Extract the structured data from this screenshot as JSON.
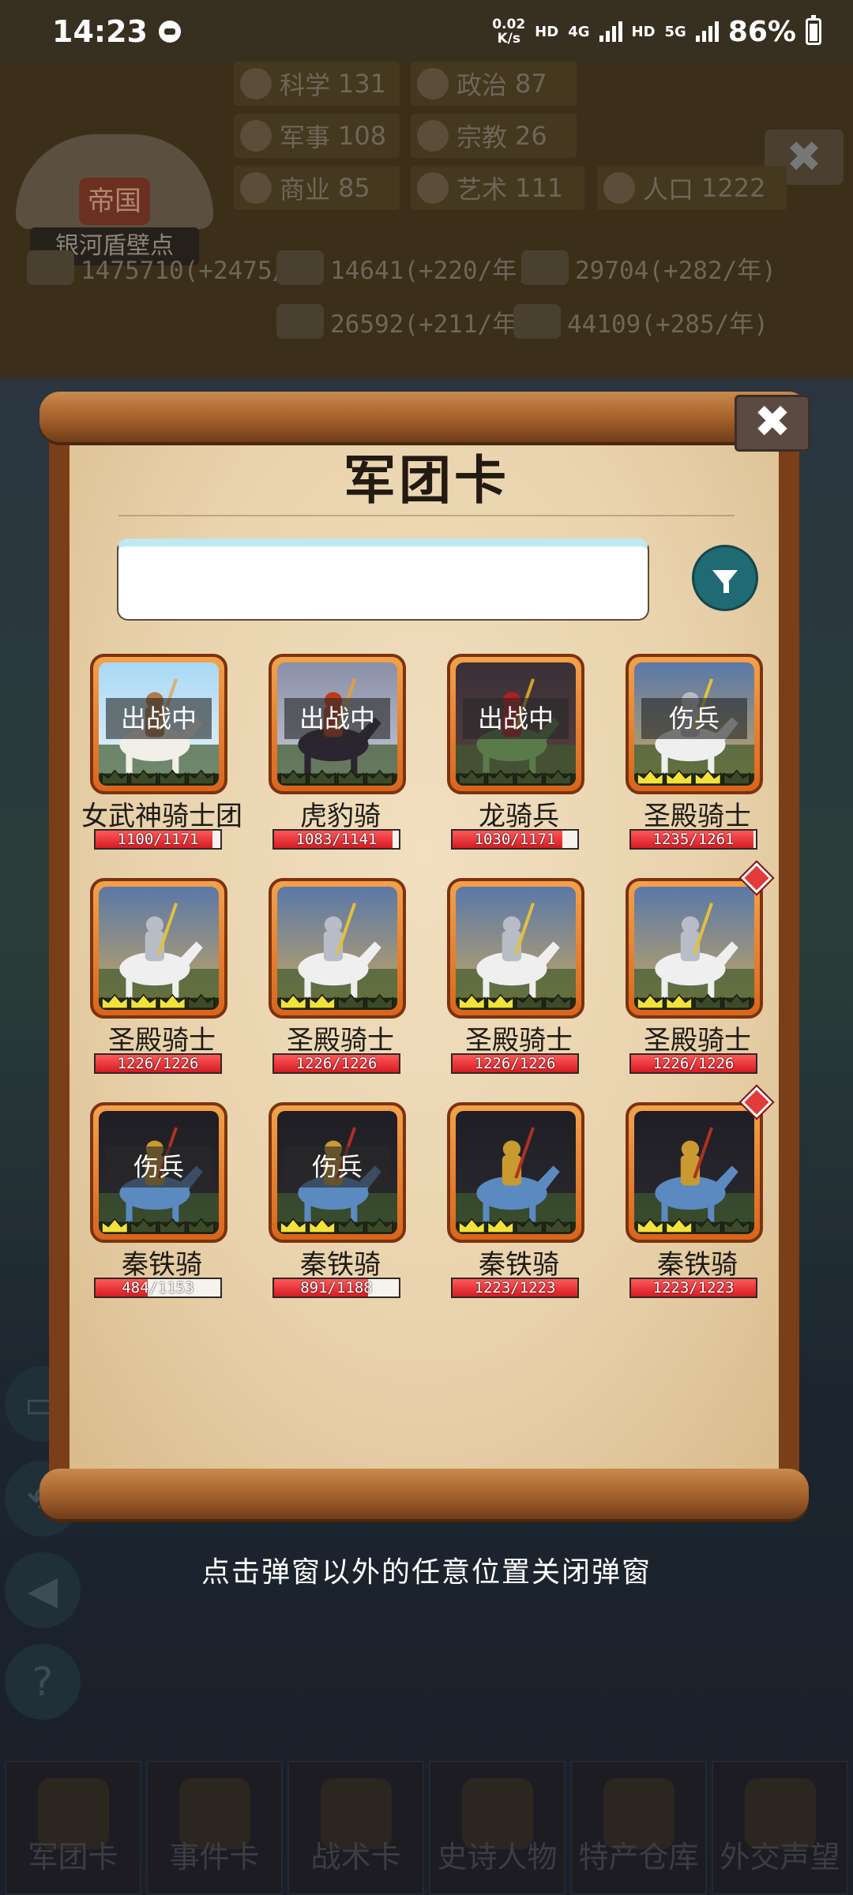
{
  "status_bar": {
    "time": "14:23",
    "net_speed_value": "0.02",
    "net_speed_unit": "K/s",
    "hd1": "HD",
    "net1": "4G",
    "hd2": "HD",
    "net2": "5G",
    "battery": "86%"
  },
  "background": {
    "emblem_title": "帝国",
    "emblem_name": "银河盾壁点",
    "stats": [
      {
        "label": "科学",
        "value": "131"
      },
      {
        "label": "政治",
        "value": "87"
      },
      {
        "label": "军事",
        "value": "108"
      },
      {
        "label": "宗教",
        "value": "26"
      },
      {
        "label": "商业",
        "value": "85"
      },
      {
        "label": "艺术",
        "value": "111"
      },
      {
        "label": "人口",
        "value": "1222"
      }
    ],
    "resources": [
      "1475710(+2475/年)",
      "14641(+220/年)",
      "29704(+282/年)",
      "26592(+211/年)",
      "44109(+285/年)"
    ],
    "close_glyph": "✖",
    "nav": [
      "军团卡",
      "事件卡",
      "战术卡",
      "史诗人物",
      "特产仓库",
      "外交声望"
    ]
  },
  "modal": {
    "title": "军团卡",
    "close_glyph": "✖",
    "search_value": "",
    "cards": [
      {
        "name": "女武神骑士团",
        "overlay": "出战中",
        "hp": "1100/1171",
        "hp_pct": 93.9,
        "art": "valkyrie",
        "crowns": 0,
        "badge": false
      },
      {
        "name": "虎豹骑",
        "overlay": "出战中",
        "hp": "1083/1141",
        "hp_pct": 94.9,
        "art": "tiger",
        "crowns": 0,
        "badge": false
      },
      {
        "name": "龙骑兵",
        "overlay": "出战中",
        "hp": "1030/1171",
        "hp_pct": 88.0,
        "art": "dragon",
        "crowns": 0,
        "badge": false
      },
      {
        "name": "圣殿骑士",
        "overlay": "伤兵",
        "hp": "1235/1261",
        "hp_pct": 97.9,
        "art": "templar",
        "crowns": 3,
        "badge": false
      },
      {
        "name": "圣殿骑士",
        "overlay": "",
        "hp": "1226/1226",
        "hp_pct": 100,
        "art": "templar",
        "crowns": 3,
        "badge": false
      },
      {
        "name": "圣殿骑士",
        "overlay": "",
        "hp": "1226/1226",
        "hp_pct": 100,
        "art": "templar",
        "crowns": 2,
        "badge": false
      },
      {
        "name": "圣殿骑士",
        "overlay": "",
        "hp": "1226/1226",
        "hp_pct": 100,
        "art": "templar",
        "crowns": 2,
        "badge": false
      },
      {
        "name": "圣殿骑士",
        "overlay": "",
        "hp": "1226/1226",
        "hp_pct": 100,
        "art": "templar",
        "crowns": 2,
        "badge": true
      },
      {
        "name": "秦铁骑",
        "overlay": "伤兵",
        "hp": "484/1153",
        "hp_pct": 42.0,
        "art": "qin",
        "crowns": 1,
        "badge": false
      },
      {
        "name": "秦铁骑",
        "overlay": "伤兵",
        "hp": "891/1188",
        "hp_pct": 75.0,
        "art": "qin",
        "crowns": 2,
        "badge": false
      },
      {
        "name": "秦铁骑",
        "overlay": "",
        "hp": "1223/1223",
        "hp_pct": 100,
        "art": "qin",
        "crowns": 2,
        "badge": false
      },
      {
        "name": "秦铁骑",
        "overlay": "",
        "hp": "1223/1223",
        "hp_pct": 100,
        "art": "qin",
        "crowns": 2,
        "badge": true
      }
    ],
    "hint": "点击弹窗以外的任意位置关闭弹窗"
  }
}
